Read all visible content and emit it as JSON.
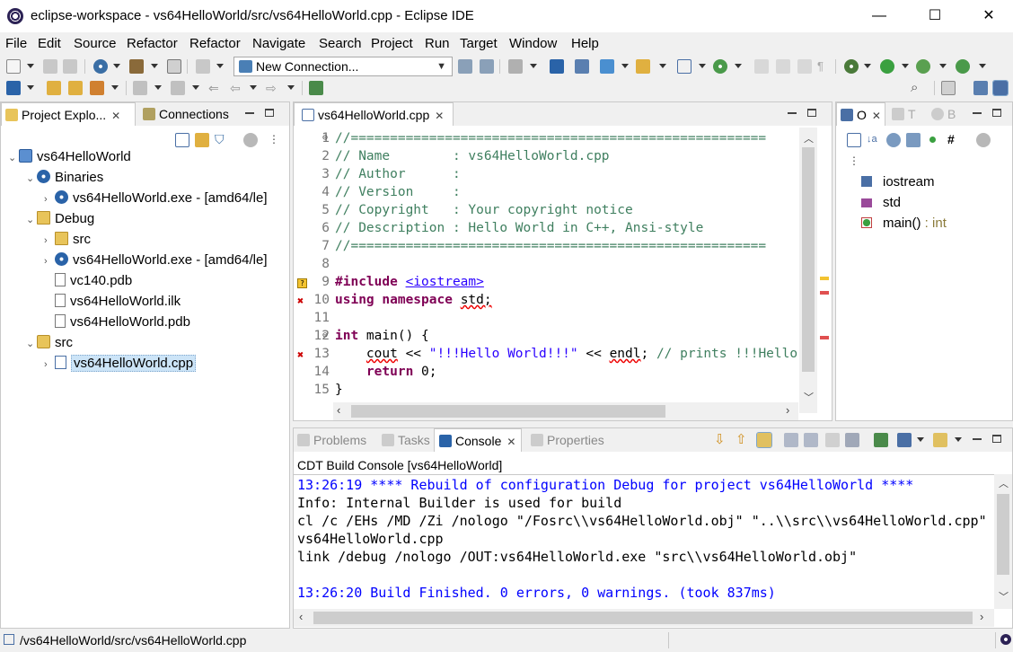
{
  "window": {
    "title": "eclipse-workspace - vs64HelloWorld/src/vs64HelloWorld.cpp - Eclipse IDE",
    "minimize": "—",
    "maximize": "☐",
    "close": "✕"
  },
  "menu": [
    "File",
    "Edit",
    "Source",
    "Refactor",
    "Refactor",
    "Navigate",
    "Search",
    "Project",
    "Run",
    "Target",
    "Window",
    "Help"
  ],
  "toolbar": {
    "connection_value": "New Connection..."
  },
  "explorer": {
    "tabs": {
      "project_explorer": "Project Explo...",
      "connections": "Connections"
    },
    "tree": [
      {
        "label": "vs64HelloWorld",
        "level": 0,
        "icon": "project-icon",
        "expanded": true
      },
      {
        "label": "Binaries",
        "level": 1,
        "icon": "binaries-icon",
        "expanded": true
      },
      {
        "label": "vs64HelloWorld.exe - [amd64/le]",
        "level": 2,
        "icon": "executable-icon",
        "expanded": false
      },
      {
        "label": "Debug",
        "level": 1,
        "icon": "folder-icon",
        "expanded": true
      },
      {
        "label": "src",
        "level": 2,
        "icon": "folder-icon",
        "expanded": false
      },
      {
        "label": "vs64HelloWorld.exe - [amd64/le]",
        "level": 2,
        "icon": "executable-icon",
        "expanded": false
      },
      {
        "label": "vc140.pdb",
        "level": 2,
        "icon": "file-icon"
      },
      {
        "label": "vs64HelloWorld.ilk",
        "level": 2,
        "icon": "file-icon"
      },
      {
        "label": "vs64HelloWorld.pdb",
        "level": 2,
        "icon": "file-icon"
      },
      {
        "label": "src",
        "level": 1,
        "icon": "source-folder-icon",
        "expanded": true
      },
      {
        "label": "vs64HelloWorld.cpp",
        "level": 2,
        "icon": "cpp-file-icon",
        "expanded": false,
        "selected": true
      }
    ]
  },
  "editor": {
    "tab": "vs64HelloWorld.cpp",
    "lines": [
      {
        "n": "1",
        "text": "//====================================================="
      },
      {
        "n": "2",
        "text": "// Name        : vs64HelloWorld.cpp"
      },
      {
        "n": "3",
        "text": "// Author      :"
      },
      {
        "n": "4",
        "text": "// Version     :"
      },
      {
        "n": "5",
        "text": "// Copyright   : Your copyright notice"
      },
      {
        "n": "6",
        "text": "// Description : Hello World in C++, Ansi-style"
      },
      {
        "n": "7",
        "text": "//====================================================="
      },
      {
        "n": "8",
        "text": ""
      },
      {
        "n": "9",
        "kw": "#include ",
        "inc": "<iostream>"
      },
      {
        "n": "10",
        "kw": "using namespace ",
        "rest": "std;"
      },
      {
        "n": "11",
        "text": ""
      },
      {
        "n": "12",
        "kw": "int ",
        "rest": "main() {"
      },
      {
        "n": "13",
        "pre": "    ",
        "err1": "cout",
        "mid": " << ",
        "str": "\"!!!Hello World!!!\"",
        "mid2": " << ",
        "err2": "endl",
        "mid3": "; ",
        "comment": "// prints !!!Hello World!!!"
      },
      {
        "n": "14",
        "pre": "    ",
        "kw": "return ",
        "rest": "0;"
      },
      {
        "n": "15",
        "text": "}"
      }
    ]
  },
  "outline": {
    "tabs": {
      "outline": "O",
      "t": "T",
      "b": "B"
    },
    "items": [
      {
        "label": "iostream",
        "type": "",
        "icon": "include-icon"
      },
      {
        "label": "std",
        "type": "",
        "icon": "namespace-icon"
      },
      {
        "label": "main()",
        "type": " : int",
        "icon": "function-icon"
      }
    ]
  },
  "bottom": {
    "tabs": {
      "problems": "Problems",
      "tasks": "Tasks",
      "console": "Console",
      "properties": "Properties"
    },
    "console_title": "CDT Build Console [vs64HelloWorld]",
    "console_lines": [
      {
        "text": "13:26:19 **** Rebuild of configuration Debug for project vs64HelloWorld ****",
        "color": "#0000ff"
      },
      {
        "text": "Info: Internal Builder is used for build",
        "color": "#000000"
      },
      {
        "text": "cl /c /EHs /MD /Zi /nologo \"/Fosrc\\\\vs64HelloWorld.obj\" \"..\\\\src\\\\vs64HelloWorld.cpp\"",
        "color": "#000000"
      },
      {
        "text": "vs64HelloWorld.cpp",
        "color": "#000000"
      },
      {
        "text": "link /debug /nologo /OUT:vs64HelloWorld.exe \"src\\\\vs64HelloWorld.obj\"",
        "color": "#000000"
      },
      {
        "text": "",
        "color": "#000000"
      },
      {
        "text": "13:26:20 Build Finished. 0 errors, 0 warnings. (took 837ms)",
        "color": "#0000ff"
      }
    ]
  },
  "status": {
    "path": "/vs64HelloWorld/src/vs64HelloWorld.cpp"
  }
}
